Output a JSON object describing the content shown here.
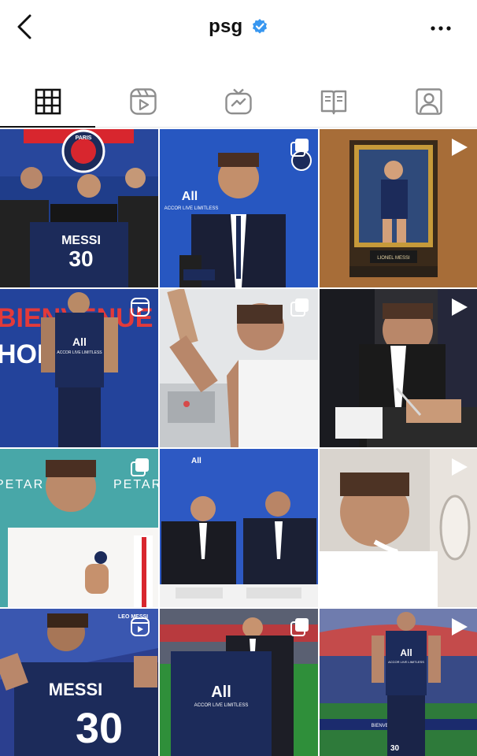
{
  "header": {
    "username": "psg",
    "verified": true,
    "back_icon": "chevron-left-icon",
    "more_icon": "more-horizontal-icon"
  },
  "tabs": [
    {
      "id": "grid",
      "icon": "grid-icon",
      "active": true
    },
    {
      "id": "reels",
      "icon": "reels-icon",
      "active": false
    },
    {
      "id": "igtv",
      "icon": "igtv-icon",
      "active": false
    },
    {
      "id": "guides",
      "icon": "guides-icon",
      "active": false
    },
    {
      "id": "tagged",
      "icon": "tagged-icon",
      "active": false
    }
  ],
  "posts": [
    {
      "kind": "carousel",
      "badge": "none",
      "texts": {
        "t1": "PARIS",
        "t2": "MESSI",
        "t3": "30"
      }
    },
    {
      "kind": "image",
      "badge": "carousel-icon",
      "texts": {
        "t1": "All",
        "t2": "ACCOR LIVE LIMITLESS"
      }
    },
    {
      "kind": "video",
      "badge": "play-icon",
      "texts": {
        "t1": "LIONEL MESSI"
      }
    },
    {
      "kind": "reel",
      "badge": "reels-icon",
      "texts": {
        "t1": "BIENVENUE",
        "t2": "HOME",
        "t3": "All",
        "t4": "ACCOR LIVE LIMITLESS"
      }
    },
    {
      "kind": "image",
      "badge": "carousel-icon",
      "texts": {}
    },
    {
      "kind": "video",
      "badge": "play-icon",
      "texts": {}
    },
    {
      "kind": "image",
      "badge": "carousel-icon",
      "texts": {
        "t1": "PETAR",
        "t2": "PETAR"
      }
    },
    {
      "kind": "image",
      "badge": "none",
      "texts": {
        "t1": "All"
      }
    },
    {
      "kind": "video",
      "badge": "play-icon",
      "texts": {}
    },
    {
      "kind": "reel",
      "badge": "reels-icon",
      "texts": {
        "t1": "LEO MESSI",
        "t2": "MESSI",
        "t3": "30"
      }
    },
    {
      "kind": "image",
      "badge": "carousel-icon",
      "texts": {
        "t1": "All",
        "t2": "ACCOR LIVE LIMITLESS"
      }
    },
    {
      "kind": "video",
      "badge": "play-icon",
      "texts": {
        "t1": "All",
        "t2": "ACCOR LIVE LIMITLESS",
        "t3": "30",
        "t4": "BIENVENUE LEO MESSI"
      }
    }
  ],
  "colors": {
    "verified_blue": "#3897f0",
    "psg_navy": "#1c2b5a",
    "psg_red": "#d8262e",
    "text": "#111111",
    "icon_gray": "#8e8e8e"
  }
}
